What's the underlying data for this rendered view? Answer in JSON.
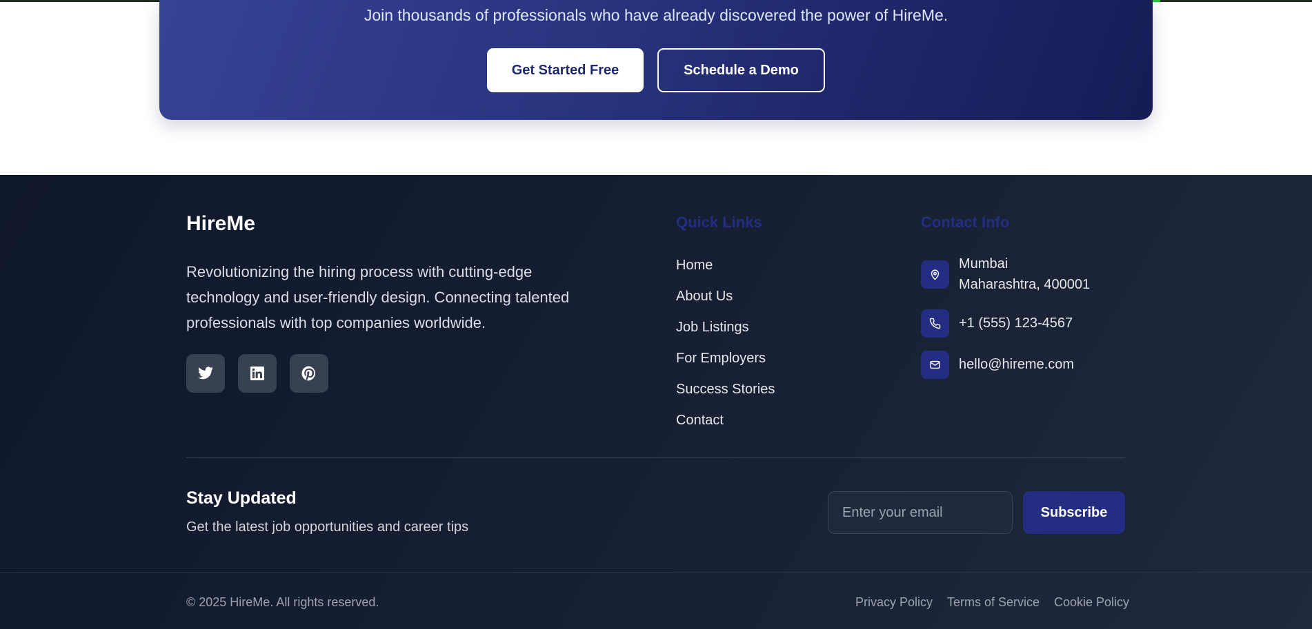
{
  "cta": {
    "subtitle": "Join thousands of professionals who have already discovered the power of HireMe.",
    "primary_button": "Get Started Free",
    "secondary_button": "Schedule a Demo"
  },
  "footer": {
    "brand": "HireMe",
    "description": "Revolutionizing the hiring process with cutting-edge technology and user-friendly design. Connecting talented professionals with top companies worldwide.",
    "social_icons": [
      "twitter-icon",
      "linkedin-icon",
      "pinterest-icon"
    ],
    "quick_links": {
      "title": "Quick Links",
      "items": [
        "Home",
        "About Us",
        "Job Listings",
        "For Employers",
        "Success Stories",
        "Contact"
      ]
    },
    "contact_info": {
      "title": "Contact Info",
      "address_line1": "Mumbai",
      "address_line2": "Maharashtra, 400001",
      "phone": "+1 (555) 123-4567",
      "email": "hello@hireme.com"
    },
    "newsletter": {
      "title": "Stay Updated",
      "subtitle": "Get the latest job opportunities and career tips",
      "placeholder": "Enter your email",
      "button": "Subscribe"
    },
    "copyright": "© 2025 HireMe. All rights reserved.",
    "legal_links": [
      "Privacy Policy",
      "Terms of Service",
      "Cookie Policy"
    ]
  },
  "colors": {
    "cta_gradient_start": "#364394",
    "cta_gradient_end": "#151c55",
    "accent": "#232e82",
    "footer_bg": "#0f172a",
    "social_bg": "#374151"
  }
}
